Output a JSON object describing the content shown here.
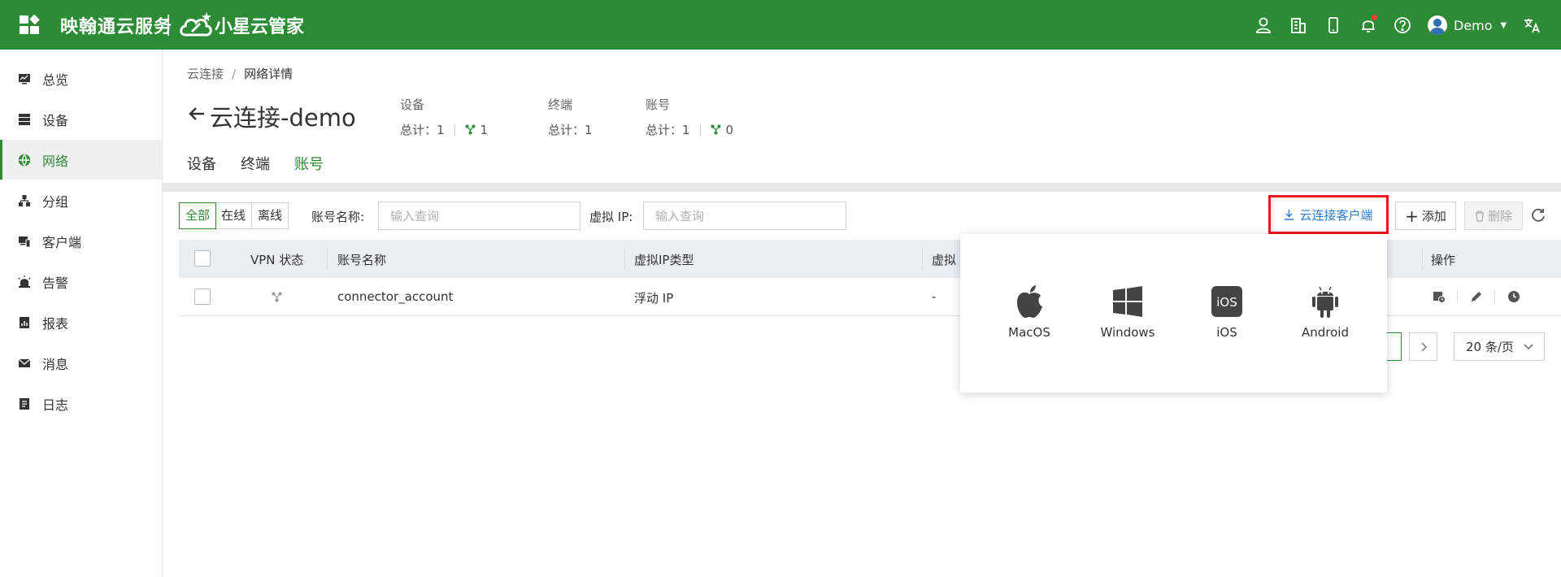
{
  "header": {
    "brand": "映翰通云服务",
    "brand2": "小星云管家",
    "user_name": "Demo",
    "icons": [
      "apps-grid-icon",
      "user-icon",
      "building-icon",
      "mobile-icon",
      "bell-icon",
      "help-icon",
      "translate-icon"
    ]
  },
  "sidebar": {
    "items": [
      {
        "label": "总览",
        "icon": "monitor-icon"
      },
      {
        "label": "设备",
        "icon": "server-icon"
      },
      {
        "label": "网络",
        "icon": "globe-icon",
        "active": true
      },
      {
        "label": "分组",
        "icon": "org-chart-icon"
      },
      {
        "label": "客户端",
        "icon": "client-icon"
      },
      {
        "label": "告警",
        "icon": "alarm-icon"
      },
      {
        "label": "报表",
        "icon": "report-icon"
      },
      {
        "label": "消息",
        "icon": "mail-icon"
      },
      {
        "label": "日志",
        "icon": "log-icon"
      }
    ]
  },
  "breadcrumb": {
    "parent": "云连接",
    "separator": "/",
    "current": "网络详情"
  },
  "page": {
    "title": "云连接-demo"
  },
  "stats": [
    {
      "label": "设备",
      "total": "总计：1",
      "online": "1"
    },
    {
      "label": "终端",
      "total": "总计：1"
    },
    {
      "label": "账号",
      "total": "总计：1",
      "online": "0"
    }
  ],
  "tabs": [
    {
      "label": "设备"
    },
    {
      "label": "终端"
    },
    {
      "label": "账号",
      "active": true
    }
  ],
  "filters": {
    "status": [
      "全部",
      "在线",
      "离线"
    ],
    "account_label": "账号名称:",
    "account_placeholder": "输入查询",
    "ip_label": "虚拟 IP:",
    "ip_placeholder": "输入查询"
  },
  "toolbar": {
    "download_label": "云连接客户端",
    "add_label": "添加",
    "delete_label": "删除"
  },
  "table": {
    "headers": [
      "VPN 状态",
      "账号名称",
      "虚拟IP类型",
      "虚拟",
      "操作"
    ],
    "rows": [
      {
        "account": "connector_account",
        "ip_type": "浮动 IP",
        "virtual": "-"
      }
    ]
  },
  "pagination": {
    "page_size": "20 条/页"
  },
  "download_menu": {
    "items": [
      {
        "label": "MacOS",
        "icon": "apple-icon"
      },
      {
        "label": "Windows",
        "icon": "windows-icon"
      },
      {
        "label": "iOS",
        "icon": "ios-icon"
      },
      {
        "label": "Android",
        "icon": "android-icon"
      }
    ]
  },
  "colors": {
    "brand": "#2e8b35",
    "link": "#2f7fd1",
    "highlight": "#e8181b"
  }
}
